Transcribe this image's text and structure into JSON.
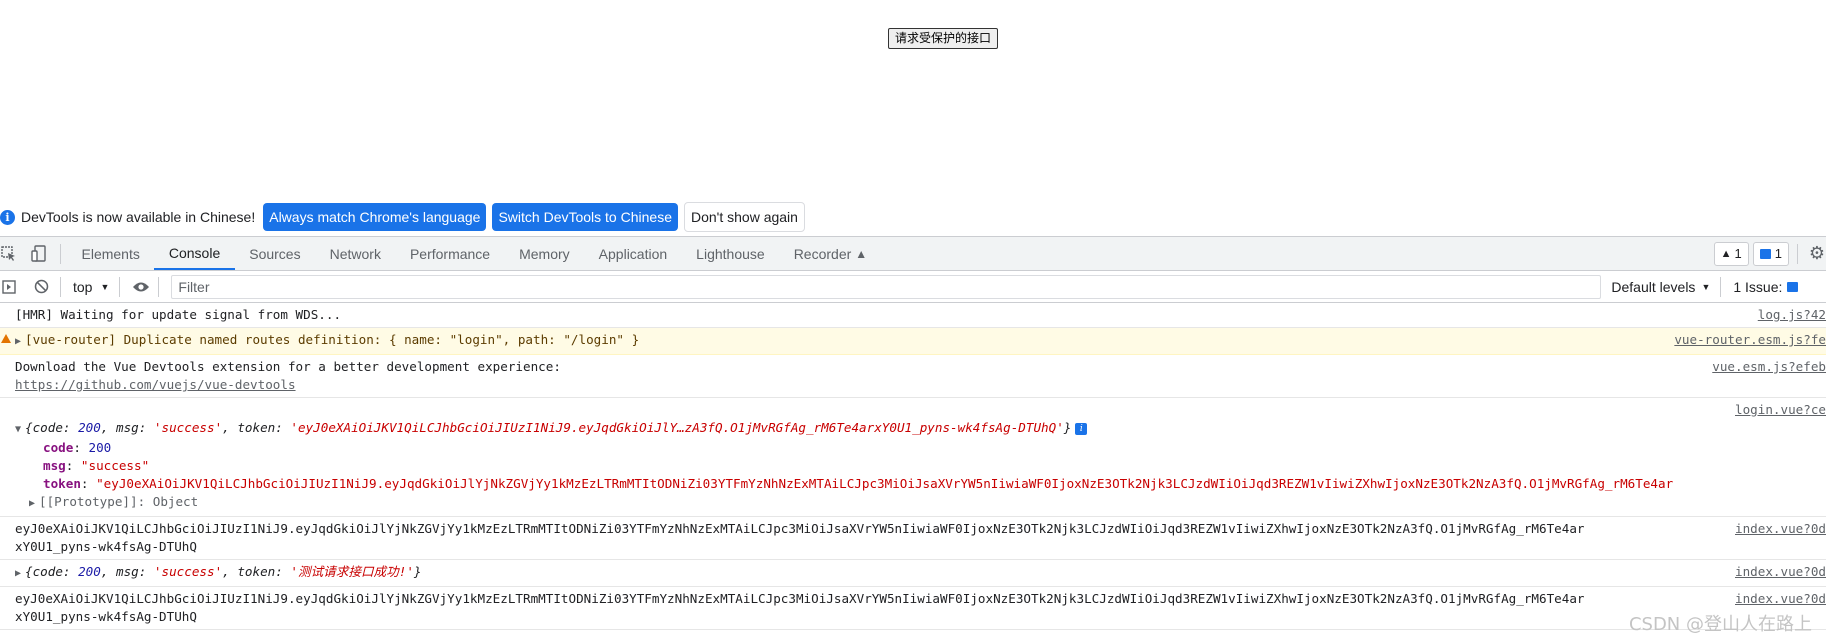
{
  "page": {
    "button_label": "请求受保护的接口"
  },
  "infobar": {
    "text": "DevTools is now available in Chinese!",
    "btn_match": "Always match Chrome's language",
    "btn_switch": "Switch DevTools to Chinese",
    "btn_dismiss": "Don't show again"
  },
  "tabs": [
    "Elements",
    "Console",
    "Sources",
    "Network",
    "Performance",
    "Memory",
    "Application",
    "Lighthouse",
    "Recorder"
  ],
  "badges": {
    "warnings": "1",
    "messages": "1"
  },
  "toolbar": {
    "context": "top",
    "filter_placeholder": "Filter",
    "levels": "Default levels",
    "issues": "1 Issue:"
  },
  "console": {
    "hmr": {
      "text": "[HMR] Waiting for update signal from WDS...",
      "src": "log.js?42"
    },
    "router": {
      "text": "[vue-router] Duplicate named routes definition: { name: \"login\", path: \"/login\" }",
      "src": "vue-router.esm.js?fe"
    },
    "devtools": {
      "line1": "Download the Vue Devtools extension for a better development experience:",
      "link": "https://github.com/vuejs/vue-devtools",
      "src": "vue.esm.js?efeb"
    },
    "obj1": {
      "src": "login.vue?ce",
      "summary_open": "{code: ",
      "code": "200",
      "mid1": ", msg: ",
      "msg": "'success'",
      "mid2": ", token: ",
      "token": "'eyJ0eXAiOiJKV1QiLCJhbGciOiJIUzI1NiJ9.eyJqdGkiOiJlY…zA3fQ.O1jMvRGfAg_rM6Te4arxY0U1_pyns-wk4fsAg-DTUhQ'",
      "close": "}",
      "code_key": "code",
      "code_val": "200",
      "msg_key": "msg",
      "msg_val": "\"success\"",
      "token_key": "token",
      "token_val": "\"eyJ0eXAiOiJKV1QiLCJhbGciOiJIUzI1NiJ9.eyJqdGkiOiJlYjNkZGVjYy1kMzEzLTRmMTItODNiZi03YTFmYzNhNzExMTAiLCJpc3MiOiJsaXVrYW5nIiwiaWF0IjoxNzE3OTk2Njk3LCJzdWIiOiJqd3REZW1vIiwiZXhwIjoxNzE3OTk2NzA3fQ.O1jMvRGfAg_rM6Te4ar",
      "proto": "[[Prototype]]: Object"
    },
    "tok1": {
      "line1": "eyJ0eXAiOiJKV1QiLCJhbGciOiJIUzI1NiJ9.eyJqdGkiOiJlYjNkZGVjYy1kMzEzLTRmMTItODNiZi03YTFmYzNhNzExMTAiLCJpc3MiOiJsaXVrYW5nIiwiaWF0IjoxNzE3OTk2Njk3LCJzdWIiOiJqd3REZW1vIiwiZXhwIjoxNzE3OTk2NzA3fQ.O1jMvRGfAg_rM6Te4ar",
      "line2": "xY0U1_pyns-wk4fsAg-DTUhQ",
      "src": "index.vue?0d"
    },
    "obj2": {
      "open": "{code: ",
      "code": "200",
      "mid1": ", msg: ",
      "msg": "'success'",
      "mid2": ", token: ",
      "token": "'测试请求接口成功!'",
      "close": "}",
      "src": "index.vue?0d"
    },
    "tok2": {
      "line1": "eyJ0eXAiOiJKV1QiLCJhbGciOiJIUzI1NiJ9.eyJqdGkiOiJlYjNkZGVjYy1kMzEzLTRmMTItODNiZi03YTFmYzNhNzExMTAiLCJpc3MiOiJsaXVrYW5nIiwiaWF0IjoxNzE3OTk2Njk3LCJzdWIiOiJqd3REZW1vIiwiZXhwIjoxNzE3OTk2NzA3fQ.O1jMvRGfAg_rM6Te4ar",
      "line2": "xY0U1_pyns-wk4fsAg-DTUhQ",
      "src": "index.vue?0d"
    }
  },
  "watermark": "CSDN @登山人在路上"
}
